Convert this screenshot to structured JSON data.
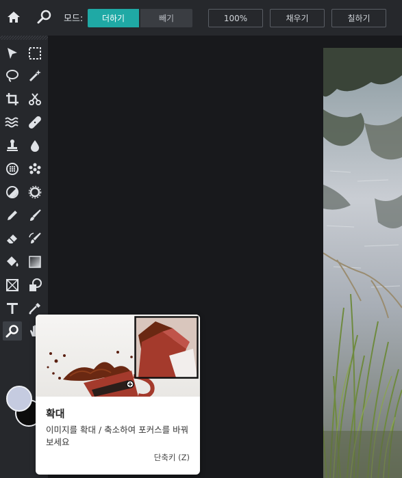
{
  "topbar": {
    "mode_label": "모드:",
    "mode_add": "더하기",
    "mode_subtract": "빼기",
    "zoom_label": "100%",
    "fill_label": "채우기",
    "paint_label": "칠하기"
  },
  "toolbar": {
    "icons": [
      "home-icon",
      "search-icon",
      "select-arrow-icon",
      "marquee-icon",
      "lasso-icon",
      "magic-wand-icon",
      "crop-icon",
      "scissors-icon",
      "liquify-icon",
      "heal-icon",
      "stamp-icon",
      "blur-drop-icon",
      "pixelate-icon",
      "scatter-icon",
      "dodge-icon",
      "sponge-icon",
      "pencil-icon",
      "brush-icon",
      "eraser-icon",
      "color-replace-icon",
      "bucket-icon",
      "gradient-icon",
      "frame-icon",
      "shapes-icon",
      "text-icon",
      "eyedropper-icon",
      "zoom-icon",
      "hand-icon"
    ]
  },
  "colors": {
    "accent": "#1fa9a5",
    "foreground_swatch": "#c5cbe0",
    "background_swatch": "#0c0c0c"
  },
  "tooltip": {
    "title": "확대",
    "description": "이미지를 확대 / 축소하여 포커스를 바꿔보세요",
    "shortcut": "단축키 (Z)"
  }
}
